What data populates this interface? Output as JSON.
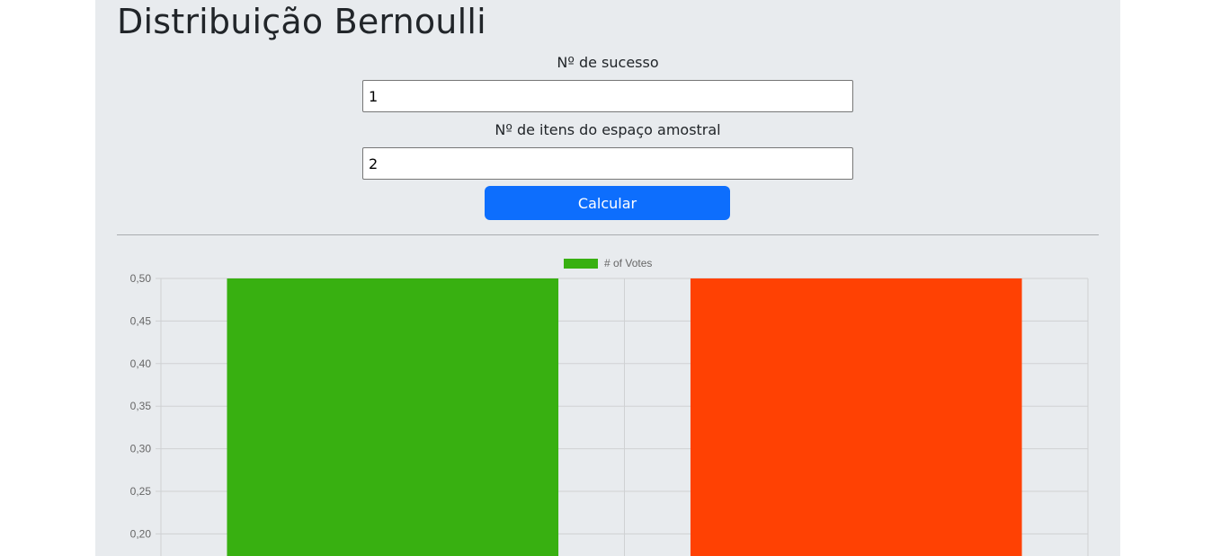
{
  "page": {
    "title": "Distribuição Bernoulli"
  },
  "form": {
    "success_label": "Nº de sucesso",
    "success_value": "1",
    "items_label": "Nº de itens do espaço amostral",
    "items_value": "2",
    "calculate_label": "Calcular"
  },
  "colors": {
    "primary_button": "#0d6efd",
    "success_bar": "#38b011",
    "failure_bar": "#ff4103"
  },
  "chart_data": {
    "type": "bar",
    "categories": [
      "",
      ""
    ],
    "series": [
      {
        "name": "# of Votes",
        "values": [
          0.5,
          0.5
        ],
        "colors": [
          "#38b011",
          "#ff4103"
        ]
      }
    ],
    "y_ticks": [
      "0,50",
      "0,45",
      "0,40",
      "0,35",
      "0,30",
      "0,25",
      "0,20"
    ],
    "ylim": [
      0.2,
      0.5
    ],
    "legend_position": "top",
    "grid": true
  }
}
